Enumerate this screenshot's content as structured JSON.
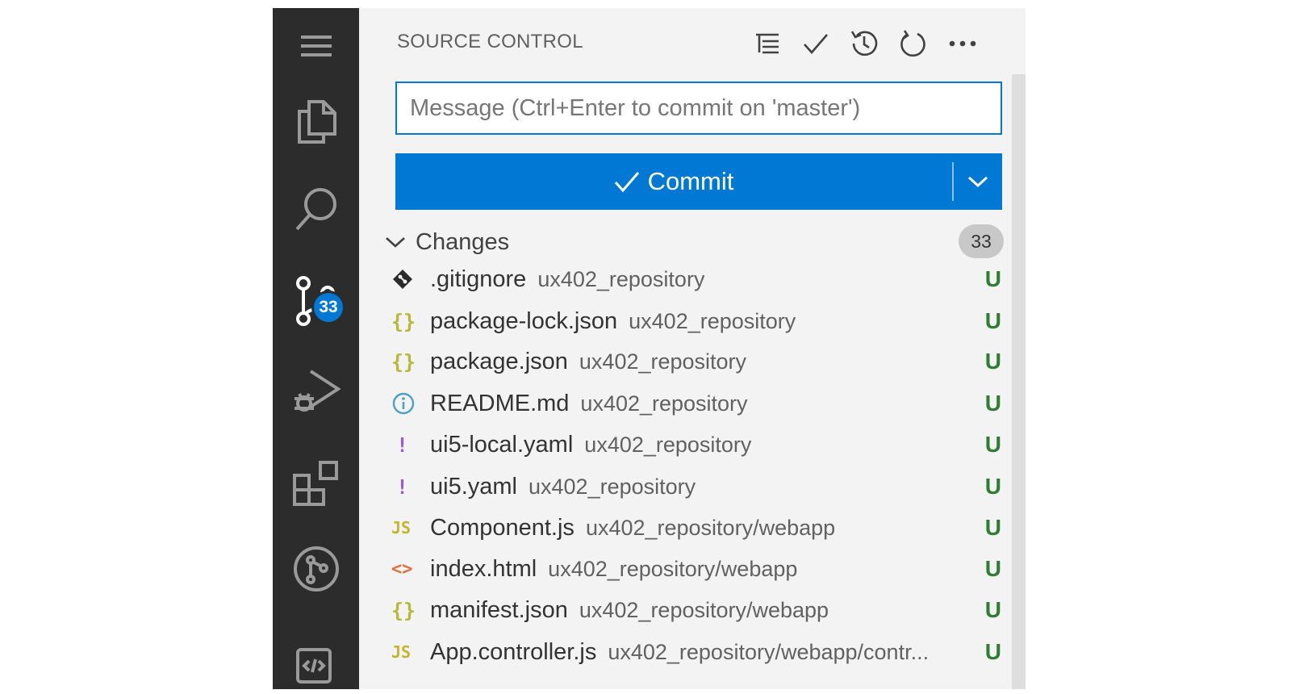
{
  "panel": {
    "title": "SOURCE CONTROL",
    "message_placeholder": "Message (Ctrl+Enter to commit on 'master')",
    "commit_label": "Commit",
    "section_label": "Changes",
    "section_count": "33"
  },
  "activity": {
    "scm_badge": "33"
  },
  "header_actions": [
    "view-as-tree-icon",
    "commit-check-icon",
    "history-icon",
    "refresh-icon",
    "more-actions-icon"
  ],
  "files": [
    {
      "name": ".gitignore",
      "path": "ux402_repository",
      "status": "U",
      "icon": "git-diamond-icon",
      "icon_text": "",
      "icon_color": "#2b2b2b"
    },
    {
      "name": "package-lock.json",
      "path": "ux402_repository",
      "status": "U",
      "icon": "json-braces-icon",
      "icon_text": "{}",
      "icon_color": "#b8b83a"
    },
    {
      "name": "package.json",
      "path": "ux402_repository",
      "status": "U",
      "icon": "json-braces-icon",
      "icon_text": "{}",
      "icon_color": "#b8b83a"
    },
    {
      "name": "README.md",
      "path": "ux402_repository",
      "status": "U",
      "icon": "info-icon",
      "icon_text": "",
      "icon_color": "#4aa0c8"
    },
    {
      "name": "ui5-local.yaml",
      "path": "ux402_repository",
      "status": "U",
      "icon": "yaml-exclamation-icon",
      "icon_text": "!",
      "icon_color": "#a05bc4"
    },
    {
      "name": "ui5.yaml",
      "path": "ux402_repository",
      "status": "U",
      "icon": "yaml-exclamation-icon",
      "icon_text": "!",
      "icon_color": "#a05bc4"
    },
    {
      "name": "Component.js",
      "path": "ux402_repository/webapp",
      "status": "U",
      "icon": "javascript-icon",
      "icon_text": "JS",
      "icon_color": "#c2b52f"
    },
    {
      "name": "index.html",
      "path": "ux402_repository/webapp",
      "status": "U",
      "icon": "html-brackets-icon",
      "icon_text": "<>",
      "icon_color": "#e0703a"
    },
    {
      "name": "manifest.json",
      "path": "ux402_repository/webapp",
      "status": "U",
      "icon": "json-braces-icon",
      "icon_text": "{}",
      "icon_color": "#b8b83a"
    },
    {
      "name": "App.controller.js",
      "path": "ux402_repository/webapp/contr...",
      "status": "U",
      "icon": "javascript-icon",
      "icon_text": "JS",
      "icon_color": "#c2b52f"
    }
  ],
  "colors": {
    "activity_bar": "#2c2c2c",
    "panel_bg": "#f3f3f3",
    "accent": "#0078d4",
    "untracked_status": "#2e7d32"
  }
}
